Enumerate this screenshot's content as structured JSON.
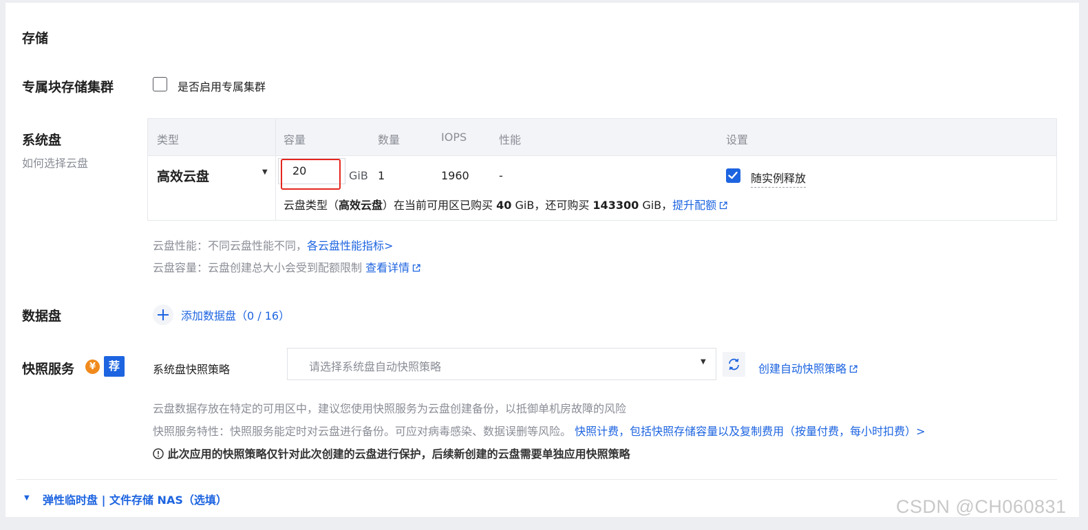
{
  "section_title": "存储",
  "dedicated_cluster": {
    "label": "专属块存储集群",
    "checkbox_text": "是否启用专属集群",
    "checked": false
  },
  "system_disk": {
    "label": "系统盘",
    "help_link": "如何选择云盘",
    "columns": [
      "类型",
      "容量",
      "数量",
      "IOPS",
      "性能",
      "设置"
    ],
    "row": {
      "type": "高效云盘",
      "capacity": "20",
      "unit": "GiB",
      "count": "1",
      "iops": "1960",
      "performance": "-",
      "release_label": "随实例释放",
      "release_checked": true
    },
    "quota": {
      "prefix": "云盘类型（",
      "type_bold": "高效云盘",
      "mid1": "）在当前可用区已购买",
      "bought_bold": "40",
      "mid2": "GiB，还可购买",
      "remain_bold": "143300",
      "mid3": "GiB，",
      "link": "提升配额"
    },
    "note_perf": "云盘性能：不同云盘性能不同，",
    "note_perf_link": "各云盘性能指标>",
    "note_cap": "云盘容量：云盘创建总大小会受到配额限制",
    "note_cap_link": "查看详情"
  },
  "data_disk": {
    "label": "数据盘",
    "add_text": "添加数据盘（0 / 16）"
  },
  "snapshot": {
    "label": "快照服务",
    "badge_yen": "¥",
    "badge_rec": "荐",
    "policy_label": "系统盘快照策略",
    "select_placeholder": "请选择系统盘自动快照策略",
    "create_link": "创建自动快照策略",
    "desc1": "云盘数据存放在特定的可用区中，建议您使用快照服务为云盘创建备份，以抵御单机房故障的风险",
    "desc2": "快照服务特性：快照服务能定时对云盘进行备份。可应对病毒感染、数据误删等风险。",
    "desc2_link": "快照计费，包括快照存储容量以及复制费用（按量付费，每小时扣费）>",
    "warning": "此次应用的快照策略仅针对此次创建的云盘进行保护，后续新创建的云盘需要单独应用快照策略"
  },
  "expand_section": "弹性临时盘 | 文件存储 NAS（选填）",
  "watermark": "CSDN @CH060831",
  "colors": {
    "accent": "#1d64e0",
    "highlight": "#e5251c",
    "badge_orange": "#f08a1c"
  }
}
